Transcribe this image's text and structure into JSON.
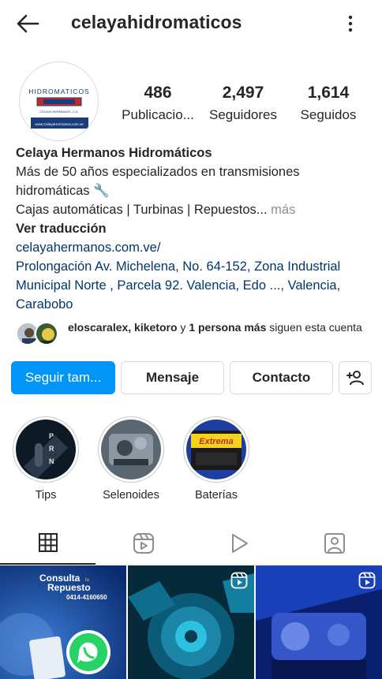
{
  "header": {
    "username": "celayahidromaticos",
    "back_icon": "arrow-left-icon",
    "menu_icon": "more-vertical-icon"
  },
  "avatar": {
    "logo_text_top": "HIDROMATICOS",
    "logo_text_brand": "CELAYA HERMANOS, C.A.",
    "logo_text_url": "www.CelayaHermanos.com.ve"
  },
  "stats": [
    {
      "value": "486",
      "label": "Publicacio..."
    },
    {
      "value": "2,497",
      "label": "Seguidores"
    },
    {
      "value": "1,614",
      "label": "Seguidos"
    }
  ],
  "bio": {
    "name": "Celaya Hermanos Hidromáticos",
    "line1": "Más de 50 años especializados en transmisiones",
    "line2": "hidromáticas 🔧",
    "line3": "Cajas automáticas | Turbinas | Repuestos...",
    "more": " más",
    "translate": "Ver traducción",
    "link": "celayahermanos.com.ve/",
    "address1": "Prolongación Av. Michelena, No. 64-152, Zona Industrial",
    "address2": "Municipal Norte , Parcela 92. Valencia, Edo ..., Valencia,",
    "address3": "Carabobo"
  },
  "followed_by": {
    "names": "eloscaralex, kiketoro",
    "connector": " y ",
    "others": "1 persona más",
    "suffix": " siguen esta cuenta"
  },
  "actions": {
    "follow": "Seguir tam...",
    "message": "Mensaje",
    "contact": "Contacto",
    "add_person_icon": "add-person-icon"
  },
  "highlights": [
    {
      "label": "Tips"
    },
    {
      "label": "Selenoides"
    },
    {
      "label": "Baterías"
    }
  ],
  "highlight_texts": {
    "battery_brand": "Extrema"
  },
  "tabs": [
    {
      "name": "grid-icon",
      "active": true
    },
    {
      "name": "reels-icon",
      "active": false
    },
    {
      "name": "play-icon",
      "active": false
    },
    {
      "name": "tagged-icon",
      "active": false
    }
  ],
  "posts": {
    "post1_title": "Consulta",
    "post1_small": "tu",
    "post1_sub": "Repuesto",
    "post1_phone": "0414-4160650"
  },
  "colors": {
    "primary": "#0095f6",
    "link": "#00376b",
    "text": "#262626"
  }
}
